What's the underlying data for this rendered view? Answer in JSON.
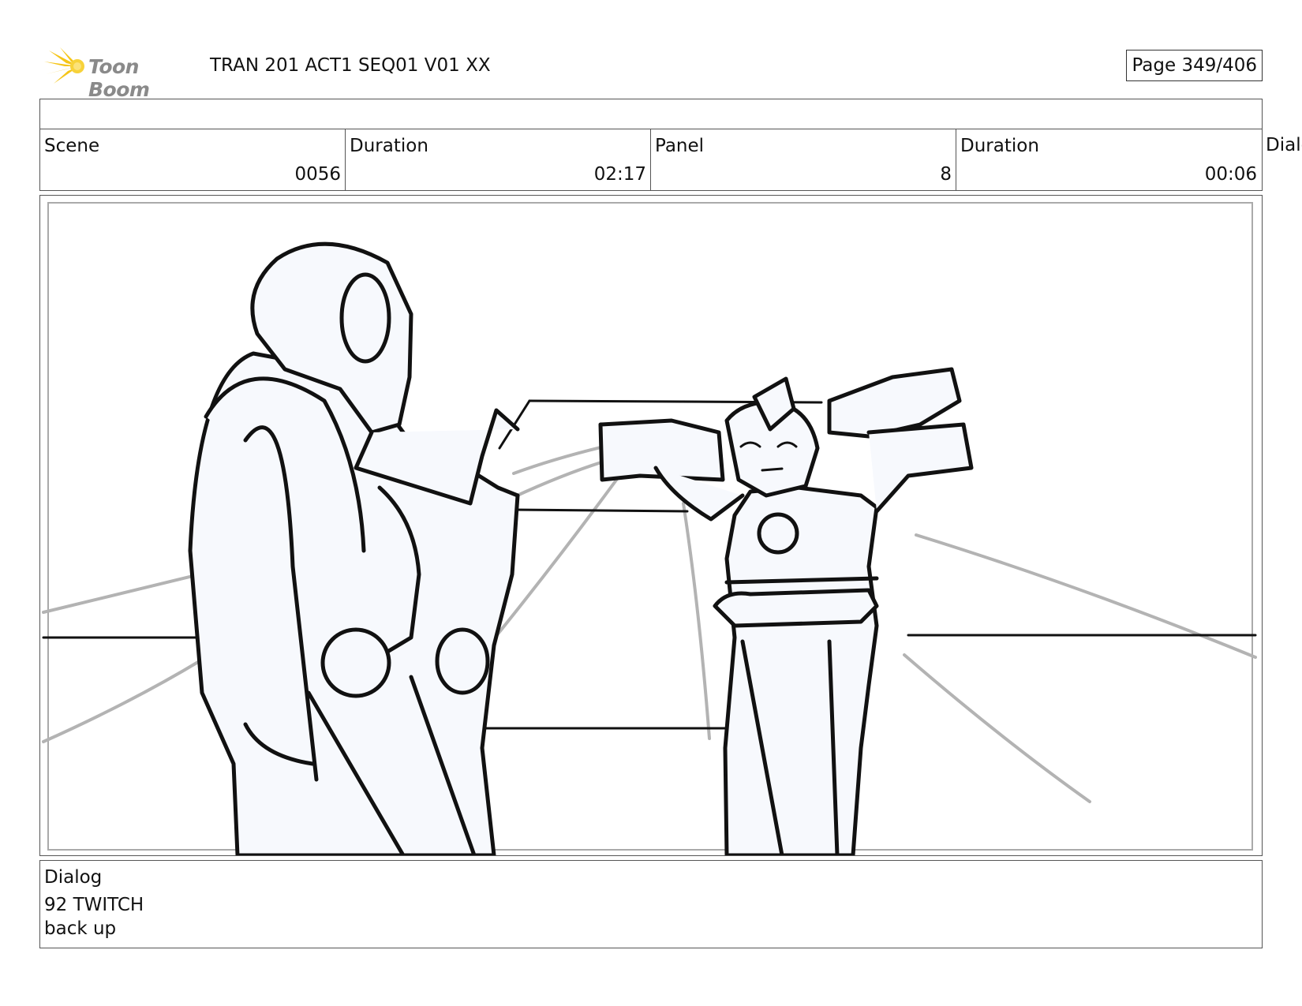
{
  "header": {
    "logo_text": "Toon Boom",
    "title": "TRAN 201 ACT1 SEQ01 V01 XX",
    "page": "Page 349/406"
  },
  "info": {
    "scene_label": "Scene",
    "scene_value": "0056",
    "scene_duration_label": "Duration",
    "scene_duration_value": "02:17",
    "panel_label": "Panel",
    "panel_value": "8",
    "panel_duration_label": "Duration",
    "panel_duration_value": "00:06",
    "overflow_label": "Dialo"
  },
  "panel_image": {
    "icon": "storyboard-sketch-two-robots"
  },
  "dialog": {
    "label": "Dialog",
    "line1": "92 TWITCH",
    "line2": "back up"
  },
  "colors": {
    "logo_star": "#f5c518",
    "logo_text": "#8a8a8a",
    "border": "#555555"
  }
}
